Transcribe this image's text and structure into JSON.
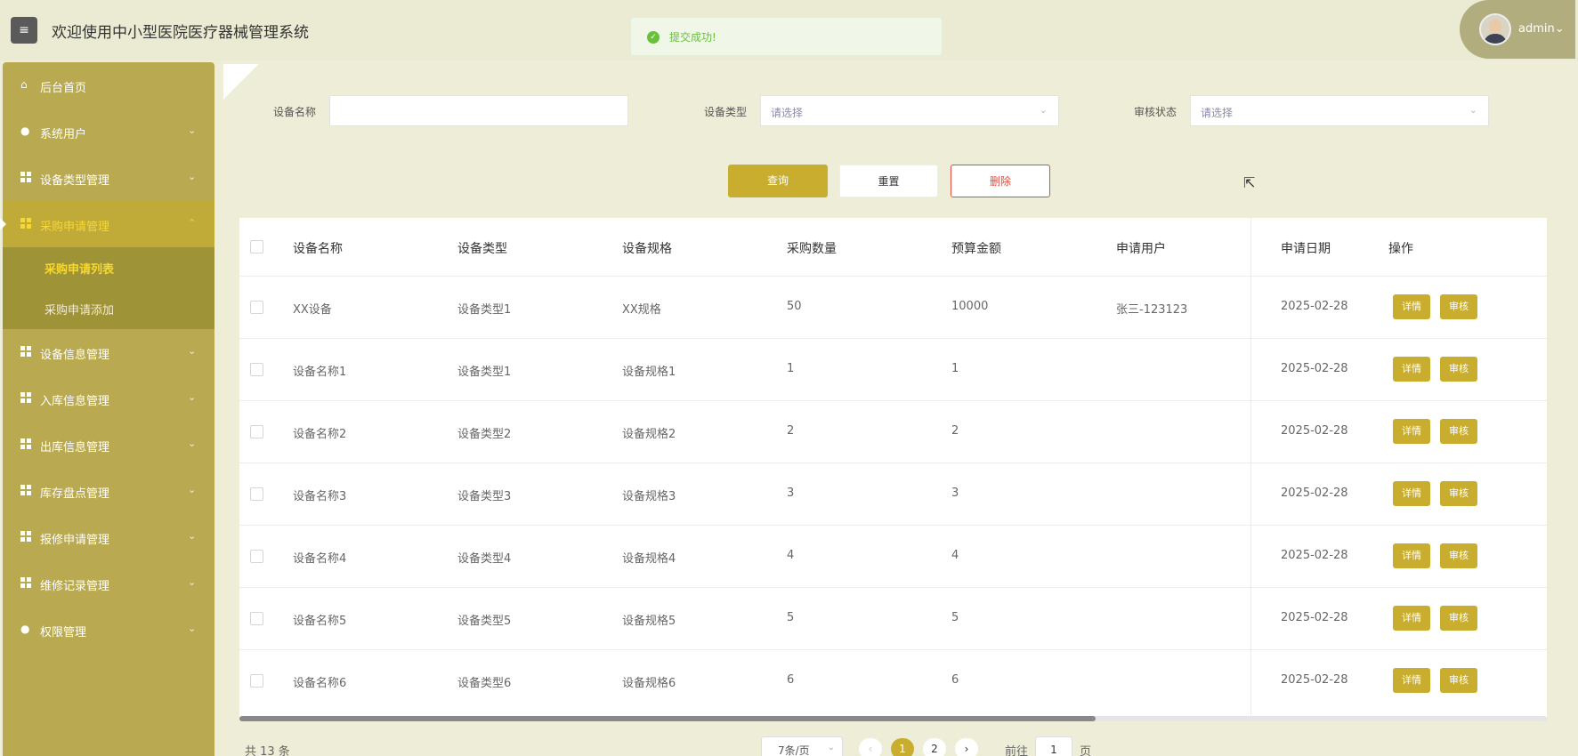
{
  "header": {
    "menu_icon": "hamburger-icon",
    "title": "欢迎使用中小型医院医疗器械管理系统",
    "toast": {
      "text": "提交成功!",
      "icon": "success-check-icon",
      "color": "#67c23a"
    },
    "user": {
      "name": "admin",
      "dropdown": "⌄"
    }
  },
  "colors": {
    "accent": "#c9ad2f",
    "sidebar": "#b9a951",
    "active_text": "#f6d830",
    "danger": "#e04b3e"
  },
  "sidebar": {
    "items": [
      {
        "label": "后台首页",
        "icon": "home-icon",
        "arrow": ""
      },
      {
        "label": "系统用户",
        "icon": "user-icon",
        "arrow": "⌄"
      },
      {
        "label": "设备类型管理",
        "icon": "grid-icon",
        "arrow": "⌄"
      },
      {
        "label": "采购申请管理",
        "icon": "grid-icon",
        "arrow": "⌃"
      },
      {
        "label": "设备信息管理",
        "icon": "grid-icon",
        "arrow": "⌄"
      },
      {
        "label": "入库信息管理",
        "icon": "grid-icon",
        "arrow": "⌄"
      },
      {
        "label": "出库信息管理",
        "icon": "grid-icon",
        "arrow": "⌄"
      },
      {
        "label": "库存盘点管理",
        "icon": "grid-icon",
        "arrow": "⌄"
      },
      {
        "label": "报修申请管理",
        "icon": "grid-icon",
        "arrow": "⌄"
      },
      {
        "label": "维修记录管理",
        "icon": "grid-icon",
        "arrow": "⌄"
      },
      {
        "label": "权限管理",
        "icon": "user-icon",
        "arrow": "⌄"
      }
    ],
    "sub_items": [
      "采购申请列表",
      "采购申请添加"
    ]
  },
  "filters": {
    "name_label": "设备名称",
    "name_value": "",
    "type_label": "设备类型",
    "type_placeholder": "请选择",
    "status_label": "审核状态",
    "status_placeholder": "请选择"
  },
  "actions": {
    "query": "查询",
    "reset": "重置",
    "delete": "删除"
  },
  "table": {
    "columns": [
      "设备名称",
      "设备类型",
      "设备规格",
      "采购数量",
      "预算金额",
      "申请用户",
      "申请日期",
      "操作"
    ],
    "rows": [
      [
        "XX设备",
        "设备类型1",
        "XX规格",
        "50",
        "10000",
        "张三-123123",
        "2025-02-28"
      ],
      [
        "设备名称1",
        "设备类型1",
        "设备规格1",
        "1",
        "1",
        "",
        "2025-02-28"
      ],
      [
        "设备名称2",
        "设备类型2",
        "设备规格2",
        "2",
        "2",
        "",
        "2025-02-28"
      ],
      [
        "设备名称3",
        "设备类型3",
        "设备规格3",
        "3",
        "3",
        "",
        "2025-02-28"
      ],
      [
        "设备名称4",
        "设备类型4",
        "设备规格4",
        "4",
        "4",
        "",
        "2025-02-28"
      ],
      [
        "设备名称5",
        "设备类型5",
        "设备规格5",
        "5",
        "5",
        "",
        "2025-02-28"
      ],
      [
        "设备名称6",
        "设备类型6",
        "设备规格6",
        "6",
        "6",
        "",
        "2025-02-28"
      ]
    ],
    "row_actions": {
      "detail": "详情",
      "audit": "审核"
    }
  },
  "pagination": {
    "total": "共 13 条",
    "page_size": "7条/页",
    "prev": "‹",
    "pages": [
      "1",
      "2"
    ],
    "current": "1",
    "next": "›",
    "goto_prefix": "前往",
    "goto_value": "1",
    "goto_suffix": "页"
  }
}
